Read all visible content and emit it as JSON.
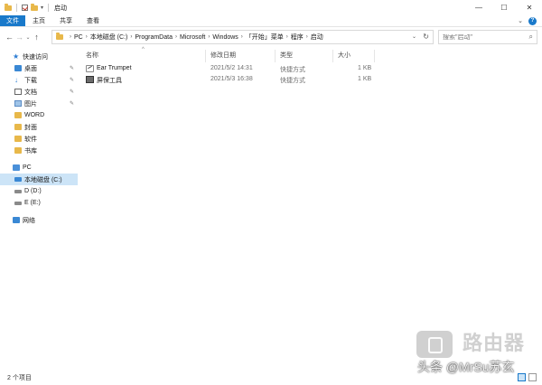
{
  "window": {
    "title": "启动"
  },
  "ribbon": {
    "tabs": [
      "文件",
      "主页",
      "共享",
      "查看"
    ]
  },
  "address": {
    "breadcrumbs": [
      "PC",
      "本地磁盘 (C:)",
      "ProgramData",
      "Microsoft",
      "Windows",
      "「开始」菜单",
      "程序",
      "启动"
    ]
  },
  "search": {
    "placeholder": "搜索\"启动\""
  },
  "sidebar": {
    "quick_access": "快速访问",
    "quick_items": [
      "桌面",
      "下载",
      "文档",
      "图片",
      "WORD",
      "封面",
      "软件",
      "书库"
    ],
    "pc": "PC",
    "drives": [
      "本地磁盘 (C:)",
      "D (D:)",
      "E (E:)"
    ],
    "network": "网络"
  },
  "columns": {
    "name": "名称",
    "modified": "修改日期",
    "type": "类型",
    "size": "大小"
  },
  "files": [
    {
      "name": "Ear Trumpet",
      "modified": "2021/5/2 14:31",
      "type": "快捷方式",
      "size": "1 KB"
    },
    {
      "name": "屏保工具",
      "modified": "2021/5/3 16:38",
      "type": "快捷方式",
      "size": "1 KB"
    }
  ],
  "status": {
    "count": "2 个项目"
  },
  "watermark": {
    "logo": "路由器",
    "credit": "头条 @MrSu苏玄"
  }
}
